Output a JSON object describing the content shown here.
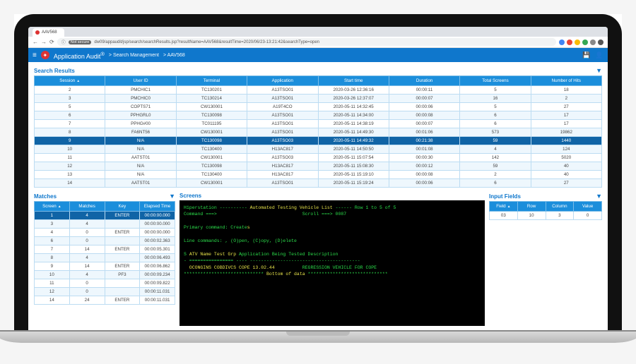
{
  "browser": {
    "tab_title": "AAV568",
    "url_insecure_label": "Not secure",
    "url": "dw09/appaudit/jsp/search/searchResults.jsp?resultName=AAV568&resultTime=2020/06/23-13:21:42&searchType=open",
    "actions": {
      "back": "←",
      "forward": "→",
      "reload": "⟳"
    }
  },
  "header": {
    "app_name": "Application Audit",
    "reg_mark": "®",
    "crumb1": "> Search Management",
    "crumb2": "> AAV568"
  },
  "section_results": "Search Results",
  "section_matches": "Matches",
  "section_screens": "Screens",
  "section_inputs": "Input Fields",
  "results": {
    "headers": [
      "Session",
      "User ID",
      "Terminal",
      "Application",
      "Start time",
      "Duration",
      "Total Screens",
      "Number of Hits"
    ],
    "rows": [
      [
        "2",
        "PMCHIC1",
        "TC130201",
        "A13TSO01",
        "2020-03-26 12:36:16",
        "00:00:11",
        "5",
        "18"
      ],
      [
        "3",
        "PMCHIC0",
        "TC130214",
        "A13TSO01",
        "2020-03-26 12:37:07",
        "00:00:07",
        "16",
        "2"
      ],
      [
        "5",
        "COPTS71",
        "CW130001",
        "A19T4CO",
        "2020-05-11 14:32:45",
        "00:00:06",
        "5",
        "27"
      ],
      [
        "6",
        "PPHGRL0",
        "TC130098",
        "A13TSO01",
        "2020-05-11 14:34:00",
        "00:00:08",
        "6",
        "17"
      ],
      [
        "7",
        "PPHG#00",
        "TC011195",
        "A13TSO01",
        "2020-05-11 14:38:19",
        "00:00:07",
        "6",
        "17"
      ],
      [
        "8",
        "FA6NT56",
        "CW130001",
        "A13TSO01",
        "2020-05-11 14:49:30",
        "00:01:06",
        "573",
        "19862"
      ],
      [
        "9",
        "N/A",
        "TC130098",
        "A13TSO03",
        "2020-05-11 14:49:32",
        "00:21:38",
        "59",
        "1440"
      ],
      [
        "10",
        "N/A",
        "TC130400",
        "H13AC817",
        "2020-05-11 14:50:50",
        "00:01:08",
        "4",
        "124"
      ],
      [
        "11",
        "AATST01",
        "CW130001",
        "A13TSO03",
        "2020-05-11 15:07:54",
        "00:00:30",
        "142",
        "5020"
      ],
      [
        "12",
        "N/A",
        "TC130098",
        "H13AC817",
        "2020-05-11 15:08:30",
        "00:00:12",
        "59",
        "40"
      ],
      [
        "13",
        "N/A",
        "TC130400",
        "H13AC817",
        "2020-05-11 15:19:10",
        "00:00:08",
        "2",
        "40"
      ],
      [
        "14",
        "AATST01",
        "CW130001",
        "A13TSO01",
        "2020-05-11 15:19:24",
        "00:00:06",
        "6",
        "27"
      ]
    ],
    "highlight_index": 6
  },
  "matches": {
    "headers": [
      "Screen",
      "Matches",
      "Key",
      "Elapsed Time"
    ],
    "rows": [
      [
        "1",
        "4",
        "ENTER",
        "00:00:00.000"
      ],
      [
        "3",
        "4",
        "",
        "00:00:00.000"
      ],
      [
        "4",
        "0",
        "ENTER",
        "00:00:00.000"
      ],
      [
        "6",
        "0",
        "",
        "00:00:02.363"
      ],
      [
        "7",
        "14",
        "ENTER",
        "00:00:05.301"
      ],
      [
        "8",
        "4",
        "",
        "00:00:06.493"
      ],
      [
        "9",
        "14",
        "ENTER",
        "00:00:06.862"
      ],
      [
        "10",
        "4",
        "PF3",
        "00:00:09.234"
      ],
      [
        "11",
        "0",
        "",
        "00:00:09.822"
      ],
      [
        "12",
        "0",
        "",
        "00:00:11.031"
      ],
      [
        "14",
        "24",
        "ENTER",
        "00:00:11.031"
      ]
    ],
    "highlight_index": 0
  },
  "inputs": {
    "headers": [
      "Field",
      "Row",
      "Column",
      "Value"
    ],
    "rows": [
      [
        "03",
        "10",
        "3",
        "0"
      ]
    ]
  },
  "terminal": {
    "l1a": "H1perstation ----------",
    "l1b": "Automated Testing Vehicle List",
    "l1c": "------ Row 1 to 5 of 5",
    "l2a": "Command ===>",
    "l2b": "Scroll ===> 0087",
    "blank": " ",
    "l3": "Primary command: Create",
    "l3b": "s",
    "l4": "Line commands: , (O)pen, (C)opy, (D)elete",
    "l5a": "S ",
    "l5b": "ATV Name Test Grp",
    "l5c": " Application Being Tested Description",
    "dash": "- ================ ---- ----------------------------------------",
    "l6a": "  OCONGINS COBDIVCS COPE 13.02.44",
    "l6b": "          REGRESSION VEHICLE FOR COPE",
    "l7a": "*****************************",
    "l7b": " Bottom of data ",
    "l7c": "*****************************"
  }
}
